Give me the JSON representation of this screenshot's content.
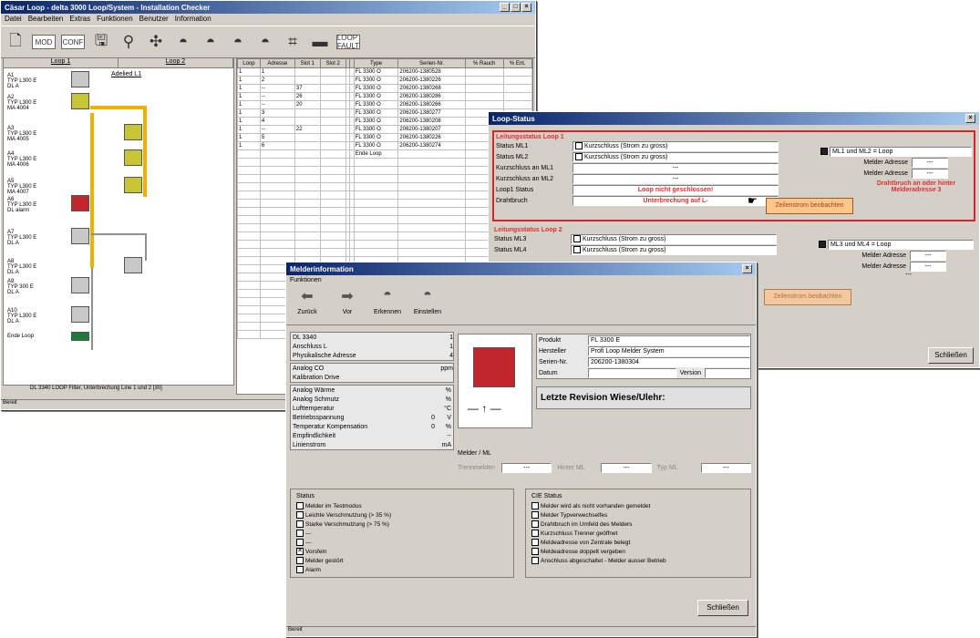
{
  "main_window": {
    "title": "Cäsar Loop - delta 3000 Loop/System - Installation Checker",
    "menu": [
      "Datei",
      "Bearbeiten",
      "Extras",
      "Funktionen",
      "Benutzer",
      "Information"
    ],
    "toolbar": [
      {
        "icon": "new-page-icon"
      },
      {
        "icon": "txt-icon",
        "label": "MOD"
      },
      {
        "icon": "txt-icon",
        "label": "CONF"
      },
      {
        "icon": "save-disk-icon"
      },
      {
        "icon": "binoculars-icon"
      },
      {
        "icon": "puzzle-icon"
      },
      {
        "icon": "detector-icon"
      },
      {
        "icon": "detector-icon"
      },
      {
        "icon": "detector-icon"
      },
      {
        "icon": "detector-icon"
      },
      {
        "icon": "chart-icon"
      },
      {
        "icon": "device-icon"
      },
      {
        "icon": "txt-icon",
        "label": "LOOP FAULT"
      }
    ],
    "tree_headers": [
      "Loop 1",
      "Loop 2"
    ],
    "tree_nodes": [
      {
        "label": "A1\nTYP L300 E\nDL A",
        "color": "gray"
      },
      {
        "label": "A2\nTYP L300 E\nMA 4004",
        "color": "yellow"
      },
      {
        "label": "A3\nTYP L300 E\nMA 4005",
        "color": "yellow"
      },
      {
        "label": "A4\nTYP L300 E\nMA 4006",
        "color": "yellow"
      },
      {
        "label": "A5\nTYP L300 E\nMA 4007",
        "color": "yellow"
      },
      {
        "label": "A6\nTYP L300 E\nDL alarm",
        "color": "red"
      },
      {
        "label": "A7\nTYP L300 E\nDL A",
        "color": "gray"
      },
      {
        "label": "A8\nTYP L300 E\nDL A",
        "color": "gray"
      },
      {
        "label": "A9\nTYP 300 E\nDL A",
        "color": "gray"
      },
      {
        "label": "A10\nTYP L300 E\nDL A",
        "color": "gray"
      },
      {
        "label": "Ende Loop",
        "color": "green"
      }
    ],
    "tree_side_label": "Adelied L1",
    "tree_status": "DL 3340 LOOP Filter, Unterbrechung Line 1 und 2  [30]",
    "statusbar": "Bereit",
    "grid_headers": [
      "Loop",
      "Adresse",
      "Slot 1",
      "Slot 2",
      "",
      "",
      "Type",
      "Serien-Nr.",
      "% Rauch",
      "% Ent."
    ],
    "grid_rows": [
      [
        "1",
        "1",
        "",
        "",
        "",
        "",
        "FL 3300 O",
        "206200-1380528",
        "",
        ""
      ],
      [
        "1",
        "2",
        "",
        "",
        "",
        "",
        "FL 3300 O",
        "206200-1380226",
        "",
        ""
      ],
      [
        "1",
        "--",
        "37",
        "",
        "",
        "",
        "FL 3300 O",
        "206200-1380268",
        "",
        ""
      ],
      [
        "1",
        "--",
        "26",
        "",
        "",
        "",
        "FL 3300 O",
        "206200-1380286",
        "",
        ""
      ],
      [
        "1",
        "--",
        "20",
        "",
        "",
        "",
        "FL 3300 O",
        "206200-1380266",
        "",
        ""
      ],
      [
        "1",
        "3",
        "",
        "",
        "",
        "",
        "FL 3300 O",
        "206200-1380277",
        "",
        ""
      ],
      [
        "1",
        "4",
        "",
        "",
        "",
        "",
        "FL 3300 O",
        "206200-1380208",
        "",
        ""
      ],
      [
        "1",
        "--",
        "22",
        "",
        "",
        "",
        "FL 3300 O",
        "206200-1380207",
        "",
        ""
      ],
      [
        "1",
        "5",
        "",
        "",
        "",
        "",
        "FL 3300 O",
        "206200-1380226",
        "",
        ""
      ],
      [
        "1",
        "6",
        "",
        "",
        "",
        "",
        "FL 3300 O",
        "206200-1380274",
        "",
        ""
      ],
      [
        "",
        "",
        "",
        "",
        "",
        "",
        "Ende Loop",
        "",
        "",
        ""
      ]
    ]
  },
  "loop_status": {
    "title": "Loop-Status",
    "sections": [
      {
        "title": "Leitungsstatus Loop 1",
        "rows": [
          {
            "label": "Status ML1",
            "checkbox": "Kurzschluss (Strom zu gross)"
          },
          {
            "label": "Status ML2",
            "checkbox": "Kurzschluss (Strom zu gross)"
          },
          {
            "label": "Kurzschluss an ML1",
            "value": "---"
          },
          {
            "label": "Kurzschluss an ML2",
            "value": "---"
          }
        ],
        "right_check": "ML1 und ML2 = Loop",
        "right_rows": [
          {
            "label": "Melder Adresse",
            "value": "---"
          },
          {
            "label": "Melder Adresse",
            "value": "---"
          }
        ],
        "loop_status_label": "Loop1 Status",
        "loop_status_value": "Loop nicht geschlossen!",
        "drahtbruch_label": "Drahtbruch",
        "drahtbruch_value": "Unterbrechung auf L-",
        "button": "Zeilenstrom beobachten",
        "warning": "Drahtbruch an oder hinter Melderadresse 3"
      },
      {
        "title": "Leitungsstatus Loop 2",
        "rows": [
          {
            "label": "Status ML3",
            "checkbox": "Kurzschluss (Strom zu gross)"
          },
          {
            "label": "Status ML4",
            "checkbox": "Kurzschluss (Strom zu gross)"
          }
        ],
        "right_check": "ML3 und ML4 = Loop",
        "right_rows": [
          {
            "label": "Melder Adresse",
            "value": "---"
          },
          {
            "label": "Melder Adresse",
            "value": "---"
          }
        ],
        "button": "Zeilenstrom beobachten",
        "warning": "---"
      }
    ],
    "close_button": "Schließen"
  },
  "device_info": {
    "title": "Melderinformation",
    "funktionen_label": "Funktionen",
    "actions": [
      {
        "label": "Zurück",
        "icon": "arrow-left-icon"
      },
      {
        "label": "Vor",
        "icon": "arrow-right-icon"
      },
      {
        "label": "Erkennen",
        "icon": "detector-icon"
      },
      {
        "label": "Einstellen",
        "icon": "detector-icon"
      }
    ],
    "addr_rows": [
      {
        "label": "DL 3340",
        "value": "1"
      },
      {
        "label": "Anschluss L",
        "value": "1"
      },
      {
        "label": "Physikalische Adresse",
        "value": "4"
      }
    ],
    "analog_rows": [
      {
        "label": "Analog CO",
        "value": "ppm"
      },
      {
        "label": "Kalibration Drive",
        "value": ""
      }
    ],
    "measure_rows": [
      {
        "label": "Analog Wärme",
        "value": "",
        "unit": "%"
      },
      {
        "label": "Analog Schmutz",
        "value": "",
        "unit": "%"
      },
      {
        "label": "Lufttemperatur",
        "value": "",
        "unit": "°C"
      },
      {
        "label": "Betriebsspannung",
        "value": "0",
        "unit": "V"
      },
      {
        "label": "Temperatur Kompensation",
        "value": "0",
        "unit": "%"
      },
      {
        "label": "Empfindlichkeit",
        "value": "",
        "unit": "--"
      },
      {
        "label": "Linienstrom",
        "value": "",
        "unit": "mA"
      }
    ],
    "product_rows": [
      {
        "label": "Produkt",
        "value": "FL 3300 E"
      },
      {
        "label": "Hersteller",
        "value": "Profi Loop Melder System"
      },
      {
        "label": "Serien-Nr.",
        "value": "206200-1380304"
      },
      {
        "label": "Datum",
        "value": "",
        "extra_label": "Version",
        "extra_value": ""
      }
    ],
    "revision_label": "Letzte Revision Wiese/Ulehr:",
    "ml_label": "Melder / ML",
    "ml_fields": [
      {
        "label": "Trennmelden",
        "value": "---"
      },
      {
        "label": "Hinter ML",
        "value": "---"
      },
      {
        "label": "Typ ML",
        "value": "---"
      }
    ],
    "status_title": "Status",
    "status_items": [
      {
        "text": "Melder im Testmodus",
        "checked": false
      },
      {
        "text": "Leichte Verschmutzung (> 35 %)",
        "checked": false
      },
      {
        "text": "Starke Verschmutzung (> 75 %)",
        "checked": false
      },
      {
        "text": "---",
        "checked": false
      },
      {
        "text": "---",
        "checked": false
      },
      {
        "text": "Vorsfeln",
        "checked": true
      },
      {
        "text": "Melder gestört",
        "checked": false
      },
      {
        "text": "Alarm",
        "checked": false
      }
    ],
    "cie_title": "CIE Status",
    "cie_items": [
      {
        "text": "Melder wird als nicht vorhanden gemeldet",
        "checked": false
      },
      {
        "text": "Melder Typverwechselfes",
        "checked": false
      },
      {
        "text": "Drahtbruch im Umfeld des Melders",
        "checked": false
      },
      {
        "text": "Kurzschluss Trenner geöffnet",
        "checked": false
      },
      {
        "text": "Meldeadresse von Zentrale belegt",
        "checked": false
      },
      {
        "text": "Meldeadresse doppelt vergeben",
        "checked": false
      },
      {
        "text": "Anschluss abgeschaltet - Melder ausser Betrieb",
        "checked": false
      }
    ],
    "close_button": "Schließen",
    "statusbar": "Bereit"
  }
}
